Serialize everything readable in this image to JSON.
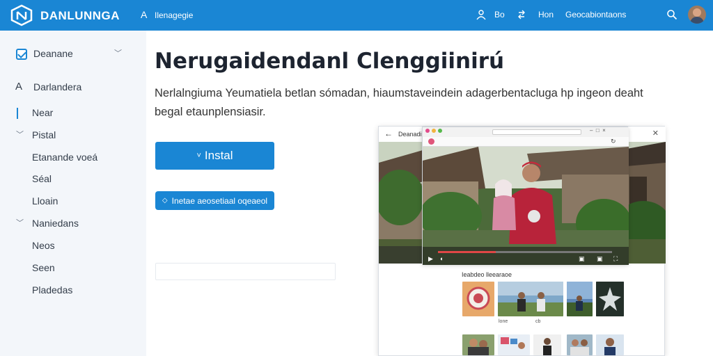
{
  "header": {
    "brand": "DANLUNNGA",
    "breadcrumb": "Ilenagegie",
    "nav": [
      "Bo",
      "Hon",
      "Geocabiontaons"
    ],
    "colors": {
      "bar": "#1a86d4",
      "text": "#ffffff"
    }
  },
  "sidebar": {
    "items": [
      {
        "label": "Deanane",
        "icon": "checkbox-icon",
        "chevron": true
      },
      {
        "label": "Darlandera",
        "icon": "a-letter-icon"
      },
      {
        "label": "Near",
        "active": true
      },
      {
        "label": "Pistal",
        "chevron": true
      },
      {
        "label": "Etanande voeá"
      },
      {
        "label": "Séal"
      },
      {
        "label": "Lloain"
      },
      {
        "label": "Naniedans",
        "chevron": true
      },
      {
        "label": "Neos"
      },
      {
        "label": "Seen"
      },
      {
        "label": "Pladedas"
      }
    ]
  },
  "main": {
    "title": "Nerugaidendanl Clenggiinirú",
    "description": "Nerlalngiuma Yeumatiela betlan sómadan, hiaumstaveindein adagerbentacluga hp ingeon deaht begal etaunplensiasir.",
    "install_label": "Instal",
    "secondary_label": "Inetae aeosetiaal oqeaeol"
  },
  "preview": {
    "window_label": "Deanadi",
    "related_title": "Ieabdeo lleearaoe",
    "video_progress": 0.33,
    "thumb_captions": [
      "lone",
      "cb",
      "",
      ""
    ]
  }
}
